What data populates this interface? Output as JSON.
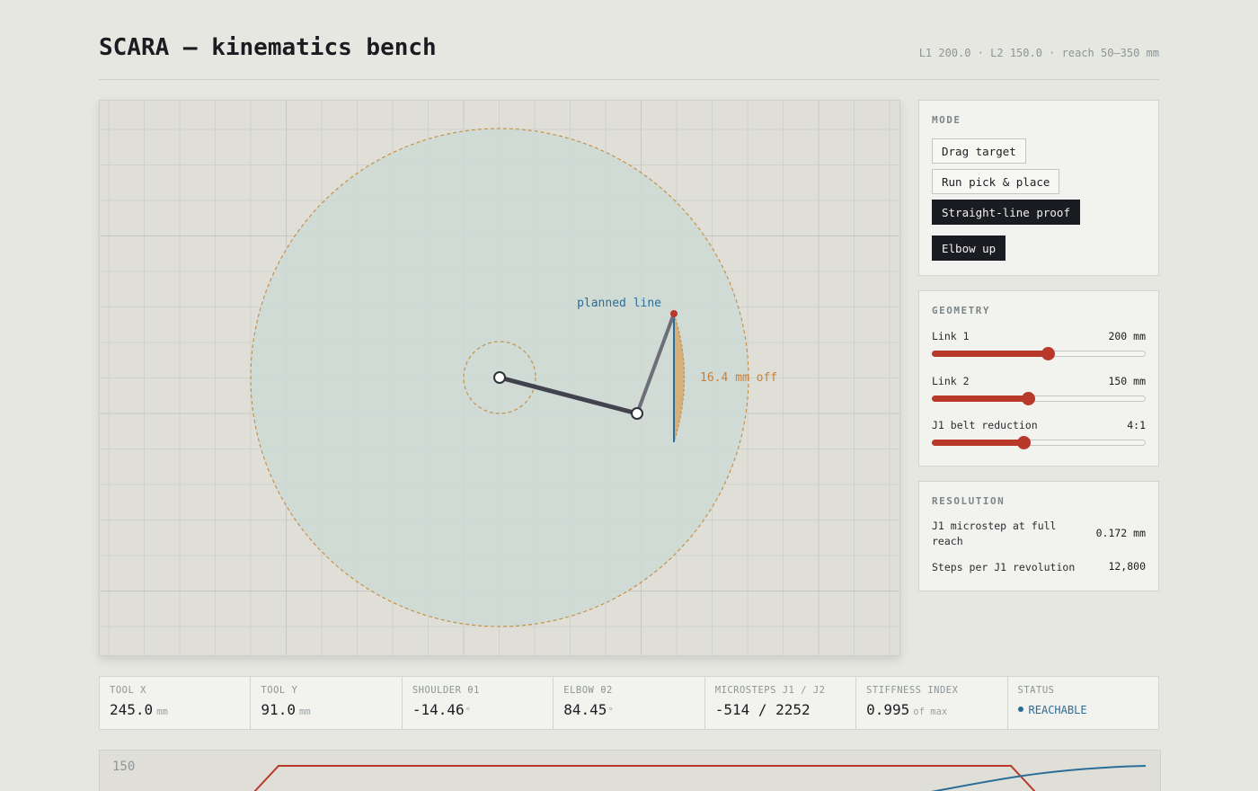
{
  "header": {
    "title": "SCARA — kinematics bench",
    "specs": "L1 200.0 · L2 150.0 · reach 50–350 mm"
  },
  "canvas": {
    "planned_line_label": "planned line",
    "deviation_label": "16.4 mm off",
    "colors": {
      "workspace_fill": "#cdd9d6",
      "envelope": "#c4924a",
      "link1": "#40424d",
      "link2": "#6c6f77",
      "planned_line": "#2a6d97",
      "deviation_fill": "#d6a86a",
      "target": "#b8382a"
    }
  },
  "mode": {
    "title": "MODE",
    "buttons": [
      {
        "label": "Drag target",
        "active": false
      },
      {
        "label": "Run pick & place",
        "active": false
      },
      {
        "label": "Straight-line proof",
        "active": true
      }
    ],
    "elbow_label": "Elbow up"
  },
  "geometry": {
    "title": "GEOMETRY",
    "sliders": [
      {
        "label": "Link 1",
        "value": "200 mm",
        "fraction": 0.54
      },
      {
        "label": "Link 2",
        "value": "150 mm",
        "fraction": 0.45
      },
      {
        "label": "J1 belt reduction",
        "value": "4:1",
        "fraction": 0.43
      }
    ]
  },
  "resolution": {
    "title": "RESOLUTION",
    "rows": [
      {
        "label": "J1 microstep at full reach",
        "value": "0.172 mm"
      },
      {
        "label": "Steps per J1 revolution",
        "value": "12,800"
      }
    ]
  },
  "readouts": {
    "tool_x": {
      "label": "TOOL X",
      "value": "245.0",
      "unit": "mm"
    },
    "tool_y": {
      "label": "TOOL Y",
      "value": "91.0",
      "unit": "mm"
    },
    "shoulder": {
      "label": "SHOULDER θ1",
      "value": "-14.46",
      "unit": "°"
    },
    "elbow": {
      "label": "ELBOW θ2",
      "value": "84.45",
      "unit": "°"
    },
    "microsteps": {
      "label": "MICROSTEPS J1 / J2",
      "value": "-514 / 2252"
    },
    "stiffness": {
      "label": "STIFFNESS INDEX",
      "value": "0.995",
      "unit": "of max"
    },
    "status": {
      "label": "STATUS",
      "value": "REACHABLE"
    }
  },
  "plot": {
    "y_label": "150",
    "colors": {
      "primary": "#b8382a",
      "secondary": "#2a6d97"
    }
  }
}
